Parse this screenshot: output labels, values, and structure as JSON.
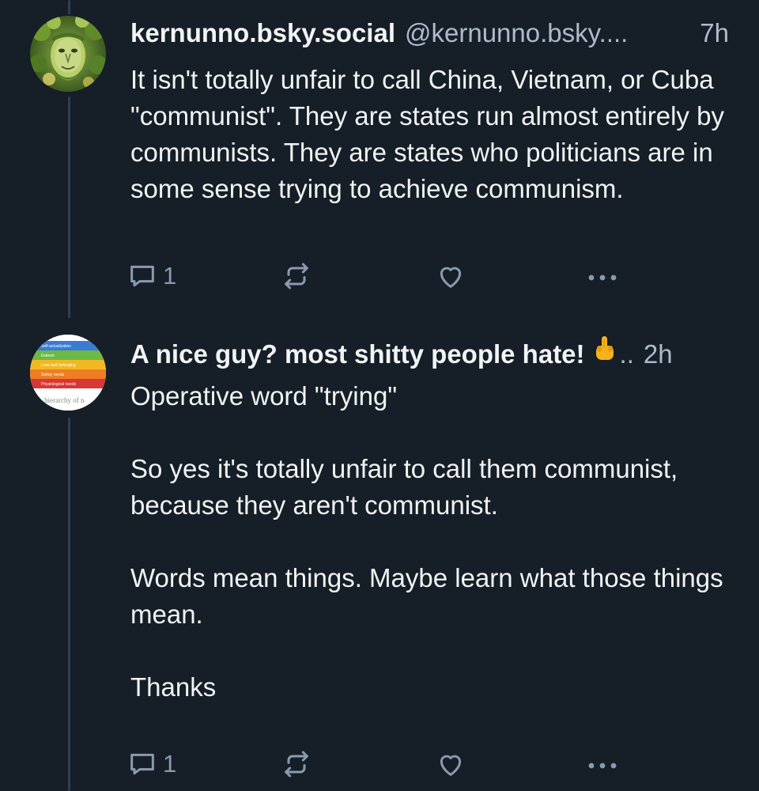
{
  "colors": {
    "background": "#161e27",
    "text_primary": "#f1f3f5",
    "text_secondary": "#aebbc9",
    "icon": "#8a9bb0",
    "thread_line": "#2e4052"
  },
  "posts": [
    {
      "display_name": "kernunno.bsky.social",
      "handle": "@kernunno.bsky....",
      "time": "7h",
      "avatar_icon": "green-man-avatar",
      "text": "It isn't totally unfair to call China, Vietnam, or Cuba \"communist\". They are states run almost entirely by communists. They are states who politicians are in some sense trying to achieve communism.",
      "reply_count": "1"
    },
    {
      "display_name": "A nice guy? most shitty people hate!",
      "emoji": "middle-finger-emoji",
      "truncation": "..",
      "time": "2h",
      "avatar_icon": "maslow-hierarchy-avatar",
      "avatar_labels": {
        "self": "Self-actualization",
        "esteem": "Esteem",
        "love": "Love and belonging",
        "safety": "Safety needs",
        "physio": "Physiological needs",
        "caption": "hierarchy of n"
      },
      "text": "Operative word \"trying\"\n\nSo yes it's totally unfair to call them communist, because they aren't communist.\n\nWords mean things. Maybe learn what those things mean.\n\nThanks",
      "reply_count": "1"
    }
  ]
}
